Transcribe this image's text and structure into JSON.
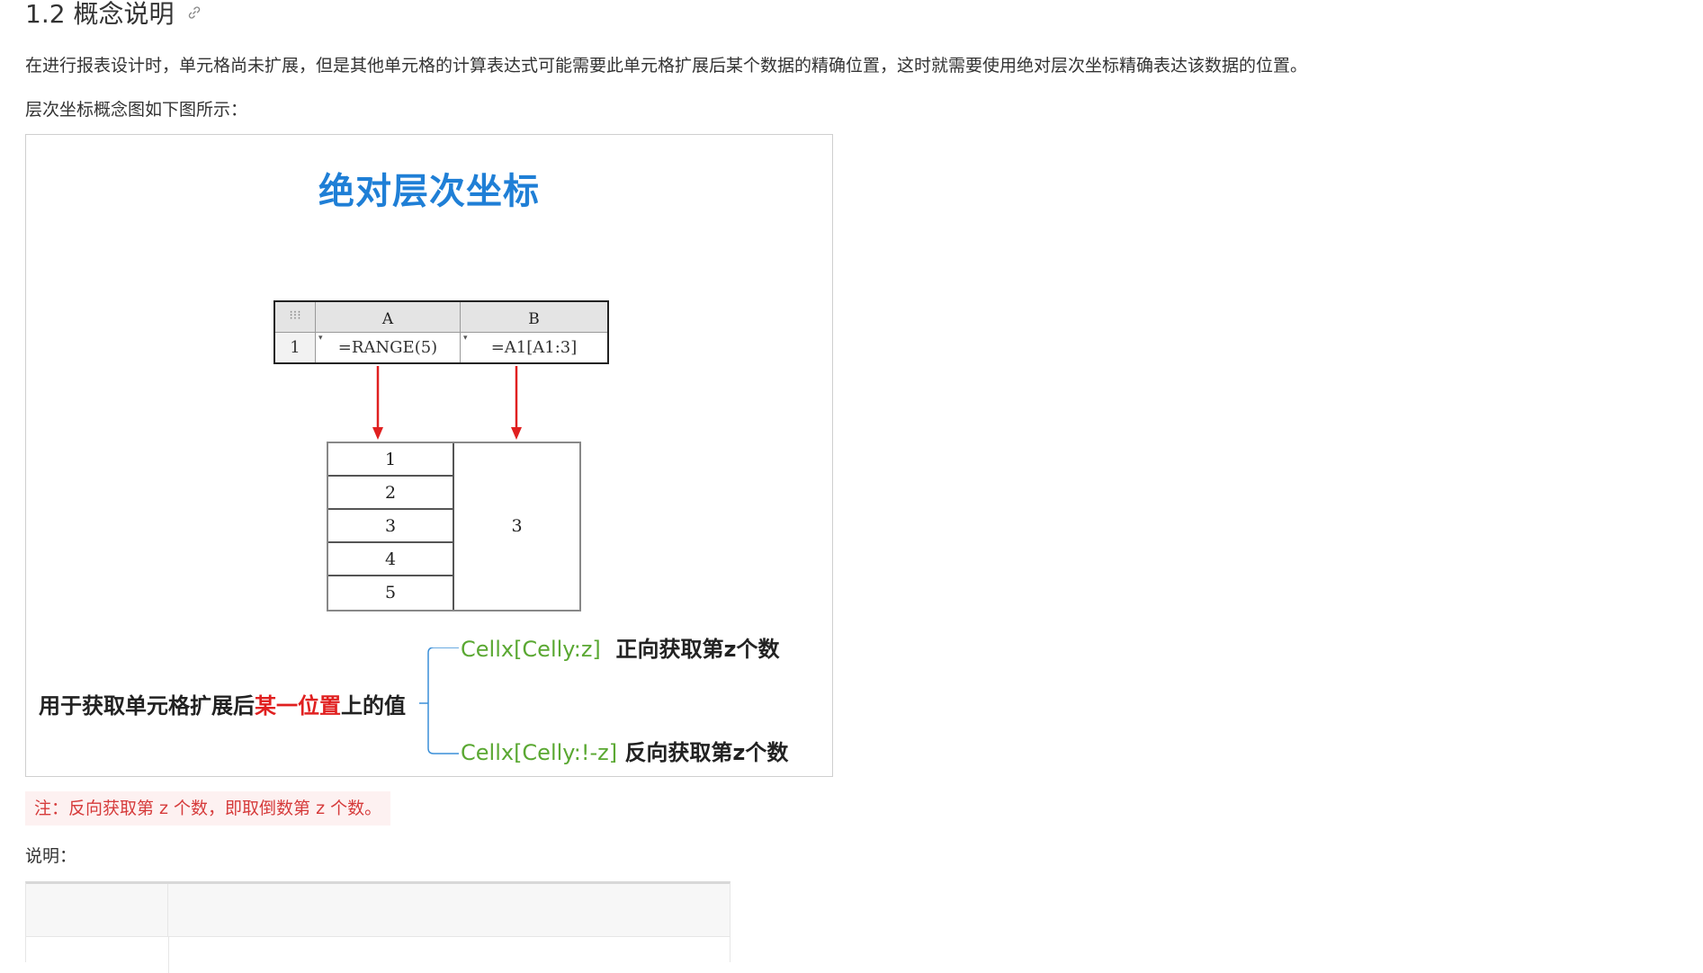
{
  "section": {
    "number": "1.2",
    "title": "概念说明"
  },
  "paragraphs": {
    "intro": "在进行报表设计时，单元格尚未扩展，但是其他单元格的计算表达式可能需要此单元格扩展后某个数据的精确位置，这时就需要使用绝对层次坐标精确表达该数据的位置。",
    "figure_lead": "层次坐标概念图如下图所示："
  },
  "figure": {
    "title": "绝对层次坐标",
    "grid": {
      "corner": "⁝⁝⁝",
      "col_a": "A",
      "col_b": "B",
      "row_num": "1",
      "cell_a": "=RANGE(5)",
      "cell_b": "=A1[A1:3]"
    },
    "result": {
      "values": [
        "1",
        "2",
        "3",
        "4",
        "5"
      ],
      "b_value": "3"
    },
    "caption_prefix": "用于获取单元格扩展后",
    "caption_highlight": "某一位置",
    "caption_suffix": "上的值",
    "branch1_code": "Cellx[Celly:z]",
    "branch1_text": "正向获取第z个数",
    "branch2_code": "Cellx[Celly:!-z]",
    "branch2_text": "反向获取第z个数"
  },
  "note": "注：反向获取第 z 个数，即取倒数第 z 个数。",
  "explain_label": "说明：",
  "colors": {
    "title_blue": "#1f7fd6",
    "arrow_red": "#e02020",
    "code_green": "#5aa832",
    "note_red": "#d63b3b",
    "note_bg": "#fdf1f1"
  }
}
